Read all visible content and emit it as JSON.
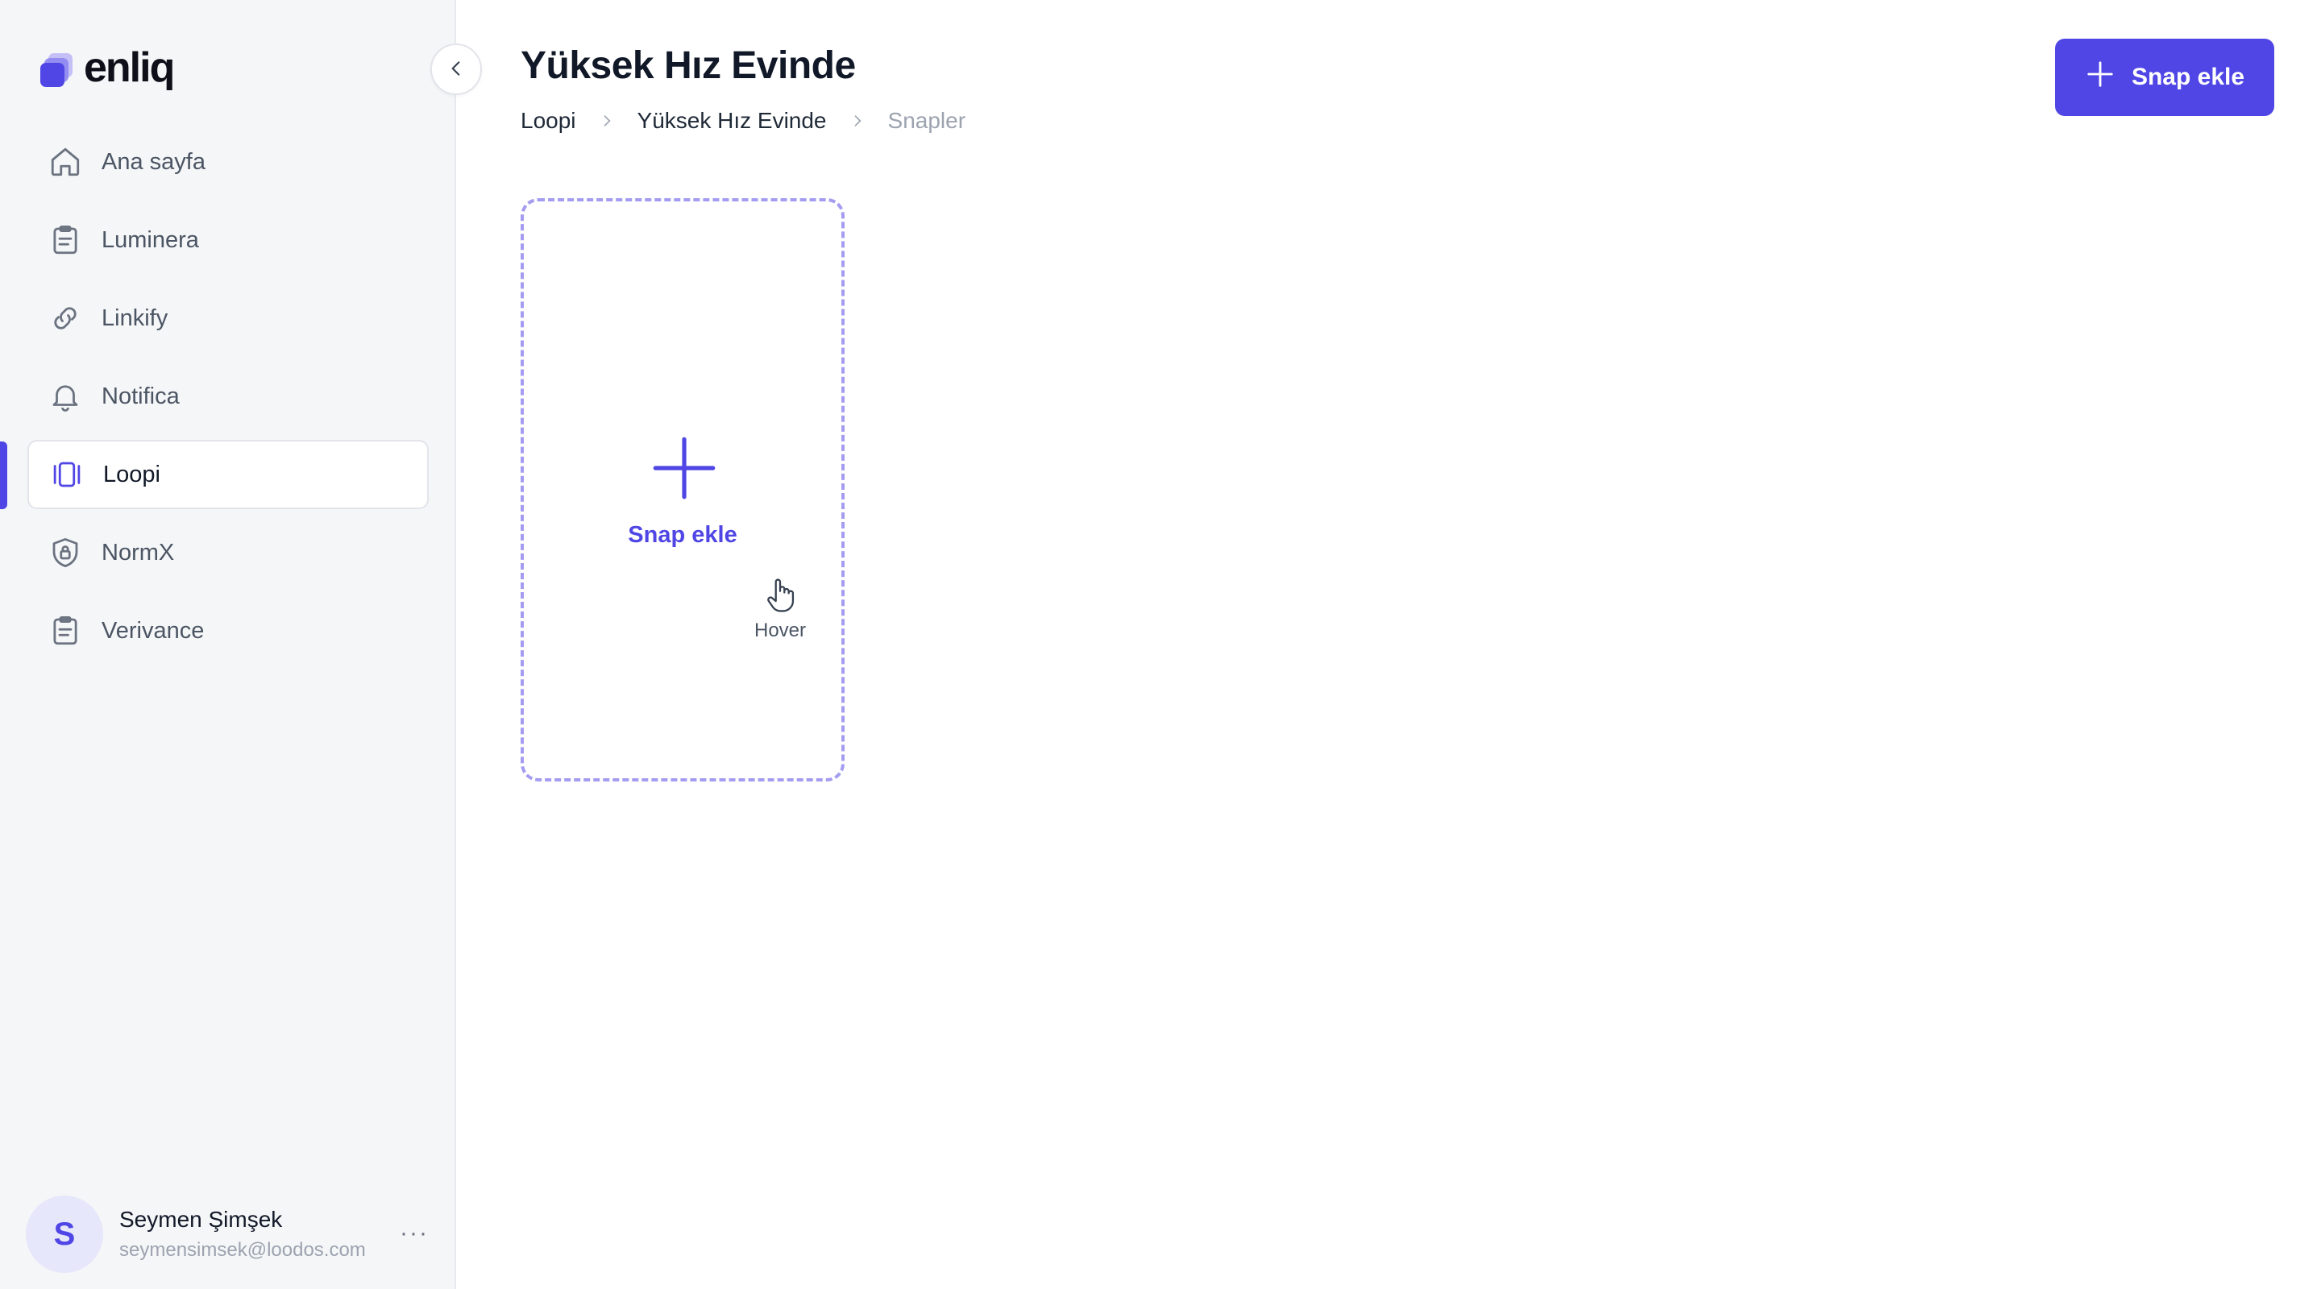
{
  "brand": {
    "name": "enliq",
    "accent": "#4f46e5"
  },
  "sidebar": {
    "items": [
      {
        "label": "Ana sayfa",
        "icon": "home-icon"
      },
      {
        "label": "Luminera",
        "icon": "clipboard-icon"
      },
      {
        "label": "Linkify",
        "icon": "link-icon"
      },
      {
        "label": "Notifica",
        "icon": "bell-icon"
      },
      {
        "label": "Loopi",
        "icon": "carousel-icon",
        "active": true
      },
      {
        "label": "NormX",
        "icon": "shield-lock-icon"
      },
      {
        "label": "Verivance",
        "icon": "clipboard-icon"
      }
    ]
  },
  "user": {
    "initial": "S",
    "name": "Seymen Şimşek",
    "email": "seymensimsek@loodos.com",
    "more": "···"
  },
  "header": {
    "title": "Yüksek Hız Evinde",
    "breadcrumb": [
      "Loopi",
      "Yüksek Hız Evinde",
      "Snapler"
    ],
    "primary_action": "Snap ekle"
  },
  "main": {
    "add_card": {
      "label": "Snap ekle",
      "hint_icon": "pointer-hand-icon",
      "hint_label": "Hover"
    }
  }
}
